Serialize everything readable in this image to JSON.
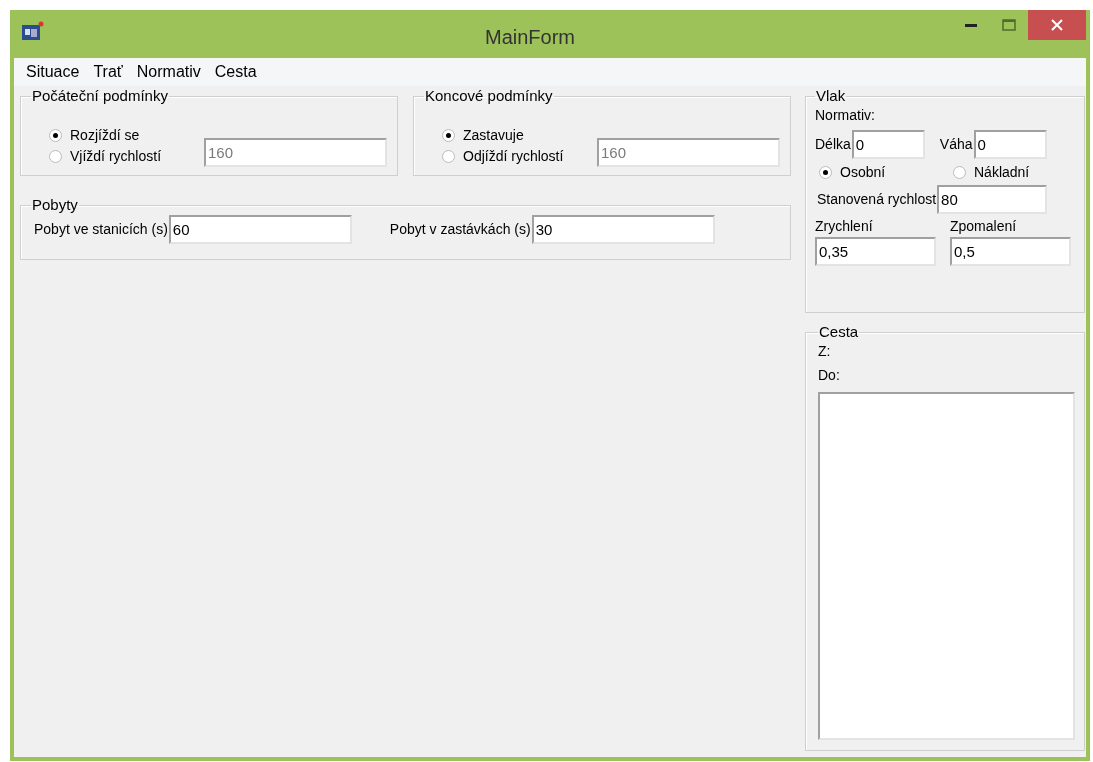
{
  "window": {
    "title": "MainForm"
  },
  "menu": [
    {
      "label": "Situace"
    },
    {
      "label": "Trať"
    },
    {
      "label": "Normativ"
    },
    {
      "label": "Cesta"
    }
  ],
  "start_conditions": {
    "title": "Počáteční podmínky",
    "options": [
      {
        "label": "Rozjíždí se",
        "selected": true
      },
      {
        "label": "Vjíždí rychlostí",
        "selected": false
      }
    ],
    "speed": {
      "value": "160",
      "disabled": true
    }
  },
  "end_conditions": {
    "title": "Koncové podmínky",
    "options": [
      {
        "label": "Zastavuje",
        "selected": true
      },
      {
        "label": "Odjíždí rychlostí",
        "selected": false
      }
    ],
    "speed": {
      "value": "160",
      "disabled": true
    }
  },
  "stays": {
    "title": "Pobyty",
    "fields": [
      {
        "label": "Pobyt ve stanicích (s)",
        "value": "60"
      },
      {
        "label": "Pobyt v zastávkách (s)",
        "value": "30"
      }
    ]
  },
  "train": {
    "title": "Vlak",
    "normative_label": "Normativ:",
    "length": {
      "label": "Délka",
      "value": "0"
    },
    "weight": {
      "label": "Váha",
      "value": "0"
    },
    "types": [
      {
        "label": "Osobní",
        "selected": true
      },
      {
        "label": "Nákladní",
        "selected": false
      }
    ],
    "speed": {
      "label": "Stanovená rychlost",
      "value": "80"
    },
    "acceleration": {
      "label": "Zrychlení",
      "value": "0,35"
    },
    "deceleration": {
      "label": "Zpomalení",
      "value": "0,5"
    }
  },
  "route": {
    "title": "Cesta",
    "from_label": "Z:",
    "to_label": "Do:"
  }
}
